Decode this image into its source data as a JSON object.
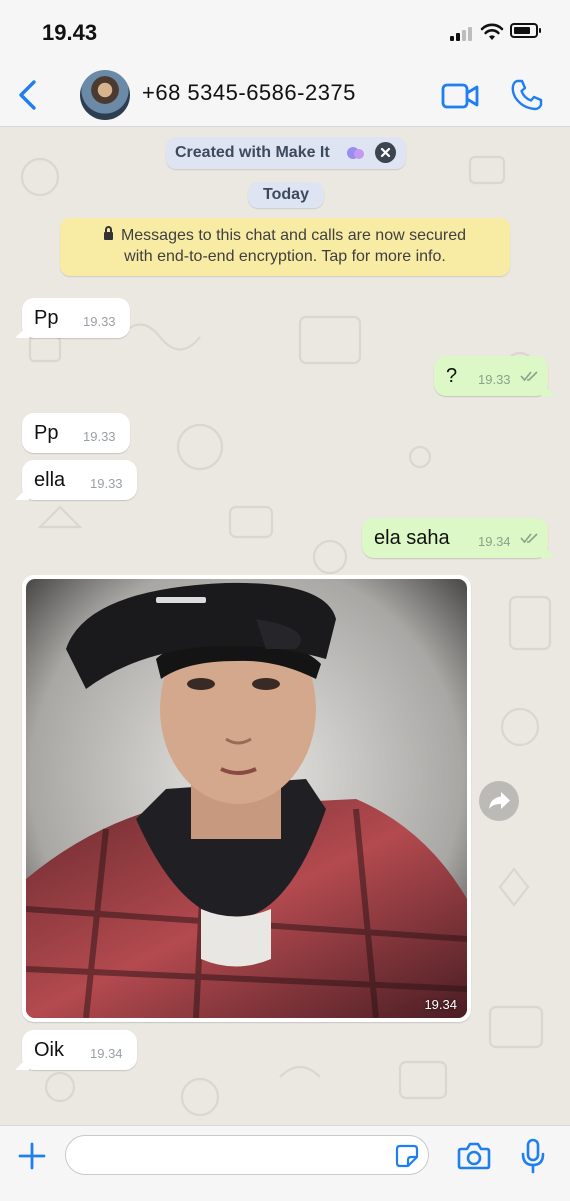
{
  "status_bar": {
    "time": "19.43",
    "battery_level": 0.8
  },
  "header": {
    "contact_name": "+68 5345-6586-2375",
    "back_icon": "chevron-left-icon",
    "video_icon": "video-camera-icon",
    "call_icon": "phone-icon",
    "accent_color": "#1f7ff0"
  },
  "chat": {
    "made_with_label": "Created with Make It",
    "date_divider": "Today",
    "encryption_notice": {
      "line1": "Messages to this chat and calls are now secured",
      "line2": "with end-to-end encryption. Tap for more info."
    },
    "messages": [
      {
        "direction": "in",
        "text": "Pp",
        "time": "19.33"
      },
      {
        "direction": "out",
        "text": "?",
        "time": "19.33",
        "status": "read"
      },
      {
        "direction": "in",
        "text": "Pp",
        "time": "19.33"
      },
      {
        "direction": "in",
        "text": "ella",
        "time": "19.33"
      },
      {
        "direction": "out",
        "text": "ela saha",
        "time": "19.34",
        "status": "read"
      },
      {
        "direction": "in",
        "type": "image",
        "time": "19.34"
      },
      {
        "direction": "in",
        "text": "Oik",
        "time": "19.34"
      }
    ],
    "incoming_bubble_color": "#ffffff",
    "outgoing_bubble_color": "#dcf8c6"
  },
  "input_bar": {
    "placeholder": "",
    "plus_icon": "plus-icon",
    "sticker_icon": "sticker-icon",
    "camera_icon": "camera-icon",
    "mic_icon": "microphone-icon"
  }
}
